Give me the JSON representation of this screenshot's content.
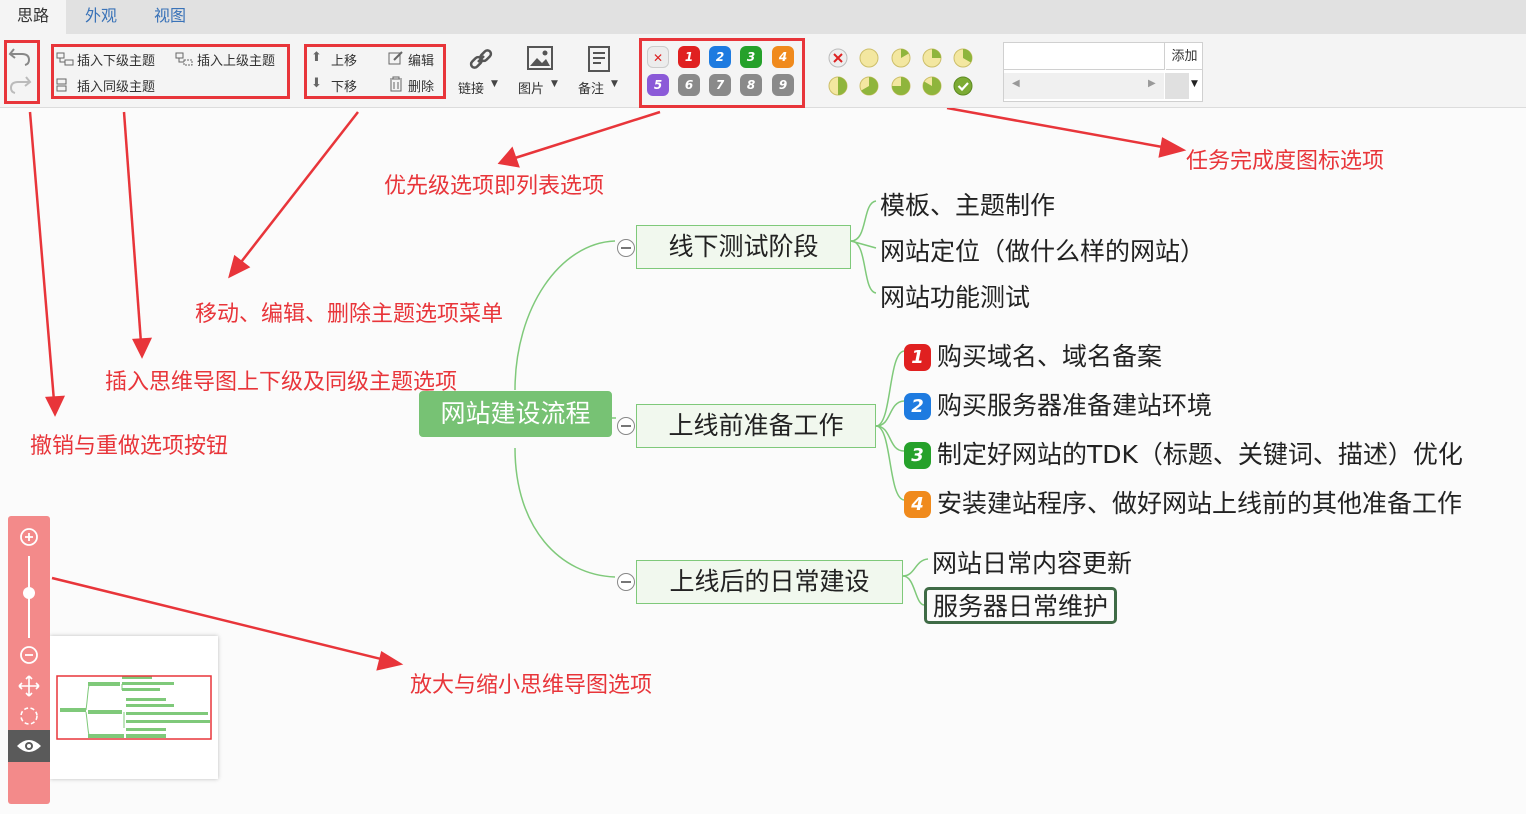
{
  "tabs": [
    "思路",
    "外观",
    "视图"
  ],
  "toolbar": {
    "insert_child": "插入下级主题",
    "insert_parent": "插入上级主题",
    "insert_sibling": "插入同级主题",
    "move_up": "上移",
    "move_down": "下移",
    "edit": "编辑",
    "delete": "删除",
    "link": "链接",
    "image": "图片",
    "note": "备注",
    "add_label": "添加",
    "priority_numbers": [
      "1",
      "2",
      "3",
      "4",
      "5",
      "6",
      "7",
      "8",
      "9"
    ]
  },
  "annotations": {
    "progress": "任务完成度图标选项",
    "priority": "优先级选项即列表选项",
    "move_edit": "移动、编辑、删除主题选项菜单",
    "insert": "插入思维导图上下级及同级主题选项",
    "undo_redo": "撤销与重做选项按钮",
    "zoom": "放大与缩小思维导图选项"
  },
  "mindmap": {
    "root": "网站建设流程",
    "branches": [
      {
        "label": "线下测试阶段",
        "children": [
          "模板、主题制作",
          "网站定位（做什么样的网站）",
          "网站功能测试"
        ]
      },
      {
        "label": "上线前准备工作",
        "children": [
          {
            "priority": "1",
            "text": "购买域名、域名备案"
          },
          {
            "priority": "2",
            "text": "购买服务器准备建站环境"
          },
          {
            "priority": "3",
            "text": "制定好网站的TDK（标题、关键词、描述）优化"
          },
          {
            "priority": "4",
            "text": "安装建站程序、做好网站上线前的其他准备工作"
          }
        ]
      },
      {
        "label": "上线后的日常建设",
        "children": [
          "网站日常内容更新",
          "服务器日常维护"
        ]
      }
    ]
  },
  "colors": {
    "accent_red": "#e8353a",
    "node_green": "#7fc97a",
    "root_green": "#77c274",
    "priority": [
      "#e02020",
      "#1e7be0",
      "#25a12a",
      "#f08a1c",
      "#8b5ad8",
      "#8a8a8a",
      "#8a8a8a",
      "#8a8a8a",
      "#8a8a8a"
    ]
  },
  "icons": [
    "undo-icon",
    "redo-icon",
    "link-icon",
    "image-icon",
    "note-icon",
    "zoom-in-icon",
    "zoom-out-icon",
    "move-icon",
    "locate-icon",
    "eye-icon"
  ]
}
